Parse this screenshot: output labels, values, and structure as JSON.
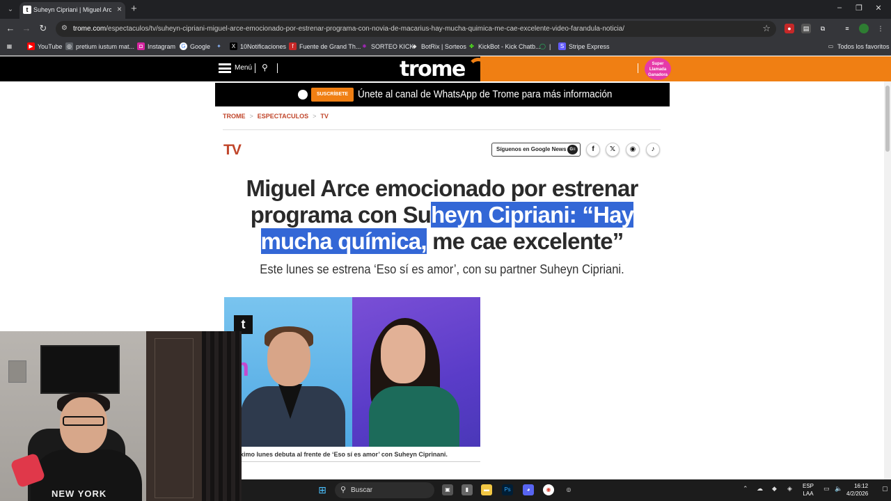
{
  "browser": {
    "tab_title": "Suheyn Cipriani | Miguel Arce e",
    "tab_favicon": "t",
    "new_tab": "+",
    "url_domain": "trome.com",
    "url_path": "/espectaculos/tv/suheyn-cipriani-miguel-arce-emocionado-por-estrenar-programa-con-novia-de-macarius-hay-mucha-quimica-me-cae-excelente-video-farandula-noticia/",
    "bookmarks": [
      {
        "label": "YouTube",
        "icon": "youtube-icon",
        "color": "#ff0000"
      },
      {
        "label": "pretium iustum mat...",
        "icon": "globe-icon",
        "color": "#5f6368"
      },
      {
        "label": "Instagram",
        "icon": "instagram-icon",
        "color": "#d6249f"
      },
      {
        "label": "Google",
        "icon": "google-icon",
        "color": "#4285f4"
      },
      {
        "label": "",
        "icon": "puzzle-icon",
        "color": "#8ab4f8"
      },
      {
        "label": "10Notificaciones",
        "icon": "x-icon",
        "color": "#000000"
      },
      {
        "label": "Fuente de Grand Th...",
        "icon": "fuente-icon",
        "color": "#c62828"
      },
      {
        "label": "SORTEO KICK",
        "icon": "kick-icon",
        "color": "#9c27b0"
      },
      {
        "label": "BotRix | Sorteos",
        "icon": "botrix-icon",
        "color": "#e0e0e0"
      },
      {
        "label": "KickBot - Kick Chatb...",
        "icon": "kickbot-icon",
        "color": "#53fc18"
      },
      {
        "label": "|",
        "icon": "whatsapp-icon",
        "color": "#25d366"
      },
      {
        "label": "Stripe Express",
        "icon": "stripe-icon",
        "color": "#635bff"
      }
    ],
    "all_favorites": "Todos los favoritos"
  },
  "site": {
    "menu_label": "Menú",
    "logo_text": "trome",
    "promo_badge": "Super Llamada Ganadora",
    "wa_subscribe": "SUSCRÍBETE",
    "wa_text": "Únete al canal de WhatsApp de Trome para más información",
    "breadcrumb": [
      "TROME",
      "ESPECTACULOS",
      "TV"
    ],
    "breadcrumb_sep": ">",
    "section": "TV",
    "google_news": "Síguenos en Google News",
    "google_news_icon": "G≡",
    "social_icons": [
      "facebook-icon",
      "x-icon",
      "whatsapp-icon",
      "tiktok-icon"
    ]
  },
  "article": {
    "headline_part1": "Miguel Arce emocionado por estrenar programa con Su",
    "headline_selected": "heyn Cipriani: “Hay mucha química,",
    "headline_part2": " me cae excelente”",
    "subtitle": "Este lunes se estrena ‘Eso sí es amor’, con su partner Suheyn Cipriani.",
    "photo_logo": "t",
    "caption": "ximo lunes debuta al frente de ‘Eso sí es amor’ con Suheyn Ciprinani."
  },
  "webcam": {
    "hoodie_text": "NEW YORK"
  },
  "taskbar": {
    "search_label": "Buscar",
    "lang_top": "ESP",
    "lang_bottom": "LAA",
    "time": "16:12",
    "date": "4/2/2026"
  },
  "colors": {
    "accent": "#f07f13",
    "section_red": "#c0452a",
    "selection": "#3367d6"
  }
}
